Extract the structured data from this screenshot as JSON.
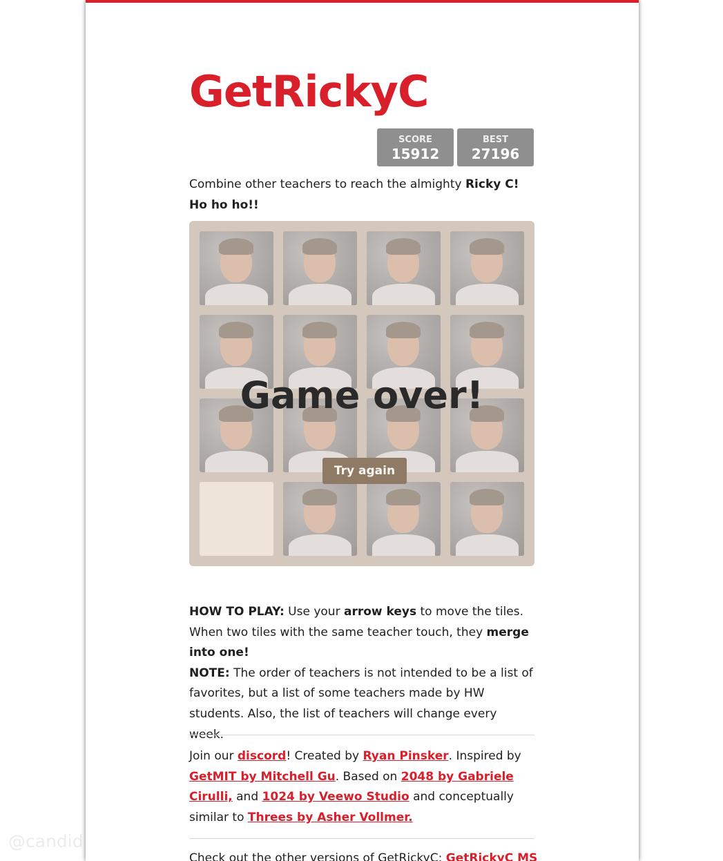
{
  "title": "GetRickyC",
  "score": {
    "label": "SCORE",
    "value": "15912"
  },
  "best": {
    "label": "BEST",
    "value": "27196"
  },
  "intro": {
    "text": "Combine other teachers to reach the almighty ",
    "bold": "Ricky C! Ho ho ho!!"
  },
  "board": {
    "size": 4,
    "tiles": [
      [
        "teacher-photo",
        "teacher-photo",
        "teacher-photo",
        "teacher-photo"
      ],
      [
        "teacher-photo",
        "teacher-photo",
        "teacher-photo",
        "teacher-photo"
      ],
      [
        "teacher-photo",
        "teacher-photo",
        "teacher-photo",
        "teacher-photo"
      ],
      [
        "empty",
        "teacher-photo",
        "teacher-photo",
        "teacher-photo"
      ]
    ]
  },
  "game_over": {
    "message": "Game over!",
    "button": "Try again"
  },
  "how_to_play": {
    "label": "HOW TO PLAY:",
    "t1": " Use your ",
    "b1": "arrow keys",
    "t2": " to move the tiles. When two tiles with the same teacher touch, they ",
    "b2": "merge into one!"
  },
  "note": {
    "label": "NOTE:",
    "text": " The order of teachers is not intended to be a list of favorites, but a list of some teachers made by HW students. Also, the list of teachers will change every week."
  },
  "credits": {
    "t1": "Join our ",
    "discord": "discord",
    "t2": "! Created by ",
    "author": "Ryan Pinsker",
    "t3": ". Inspired by ",
    "getmit": "GetMIT by Mitchell Gu",
    "t4": ". Based on ",
    "g2048": "2048 by Gabriele Cirulli,",
    "t5": " and ",
    "g1024": "1024 by Veewo Studio",
    "t6": " and conceptually similar to ",
    "threes": "Threes by Asher Vollmer."
  },
  "other_versions": {
    "text": "Check out the other versions of GetRickyC: ",
    "link": "GetRickyC MS"
  },
  "watermark": "@candid",
  "colors": {
    "accent": "#d81f2a",
    "board": "#bbada0",
    "empty_tile": "#eee4da",
    "button": "#8f7a66",
    "score_box": "#8f8f8f"
  }
}
